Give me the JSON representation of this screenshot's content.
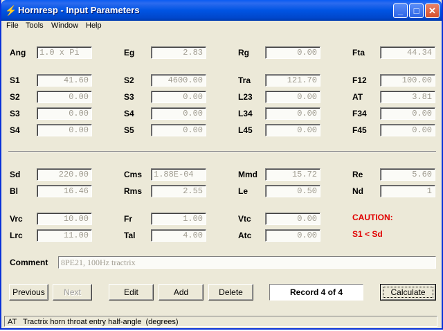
{
  "window": {
    "title": "Hornresp - Input Parameters"
  },
  "menu": [
    "File",
    "Tools",
    "Window",
    "Help"
  ],
  "rows_top": [
    [
      {
        "label": "Ang",
        "value": "1.0 x Pi",
        "align": "left"
      },
      {
        "label": "Eg",
        "value": "2.83"
      },
      {
        "label": "Rg",
        "value": "0.00"
      },
      {
        "label": "Fta",
        "value": "44.34"
      }
    ],
    [
      {
        "label": "S1",
        "value": "41.60"
      },
      {
        "label": "S2",
        "value": "4600.00"
      },
      {
        "label": "Tra",
        "value": "121.70"
      },
      {
        "label": "F12",
        "value": "100.00"
      }
    ],
    [
      {
        "label": "S2",
        "value": "0.00"
      },
      {
        "label": "S3",
        "value": "0.00"
      },
      {
        "label": "L23",
        "value": "0.00"
      },
      {
        "label": "AT",
        "value": "3.81"
      }
    ],
    [
      {
        "label": "S3",
        "value": "0.00"
      },
      {
        "label": "S4",
        "value": "0.00"
      },
      {
        "label": "L34",
        "value": "0.00"
      },
      {
        "label": "F34",
        "value": "0.00"
      }
    ],
    [
      {
        "label": "S4",
        "value": "0.00"
      },
      {
        "label": "S5",
        "value": "0.00"
      },
      {
        "label": "L45",
        "value": "0.00"
      },
      {
        "label": "F45",
        "value": "0.00"
      }
    ]
  ],
  "rows_bottom": [
    [
      {
        "label": "Sd",
        "value": "220.00"
      },
      {
        "label": "Cms",
        "value": "1.88E-04",
        "align": "left"
      },
      {
        "label": "Mmd",
        "value": "15.72"
      },
      {
        "label": "Re",
        "value": "5.60"
      }
    ],
    [
      {
        "label": "Bl",
        "value": "16.46"
      },
      {
        "label": "Rms",
        "value": "2.55"
      },
      {
        "label": "Le",
        "value": "0.50"
      },
      {
        "label": "Nd",
        "value": "1"
      }
    ],
    [
      {
        "label": "Vrc",
        "value": "10.00"
      },
      {
        "label": "Fr",
        "value": "1.00"
      },
      {
        "label": "Vtc",
        "value": "0.00"
      }
    ],
    [
      {
        "label": "Lrc",
        "value": "11.00"
      },
      {
        "label": "Tal",
        "value": "4.00"
      },
      {
        "label": "Atc",
        "value": "0.00"
      }
    ]
  ],
  "caution": {
    "title": "CAUTION:",
    "message": "S1 < Sd"
  },
  "comment": {
    "label": "Comment",
    "value": "8PE21, 100Hz tractrix"
  },
  "buttons": {
    "previous": "Previous",
    "next": "Next",
    "edit": "Edit",
    "add": "Add",
    "delete": "Delete",
    "calculate": "Calculate"
  },
  "record": "Record 4 of 4",
  "status": "AT   Tractrix horn throat entry half-angle  (degrees)",
  "colors": {
    "titlebar": "#0054e3",
    "caution": "#e00000",
    "field_text": "#a09c90",
    "background": "#ece9d8"
  }
}
